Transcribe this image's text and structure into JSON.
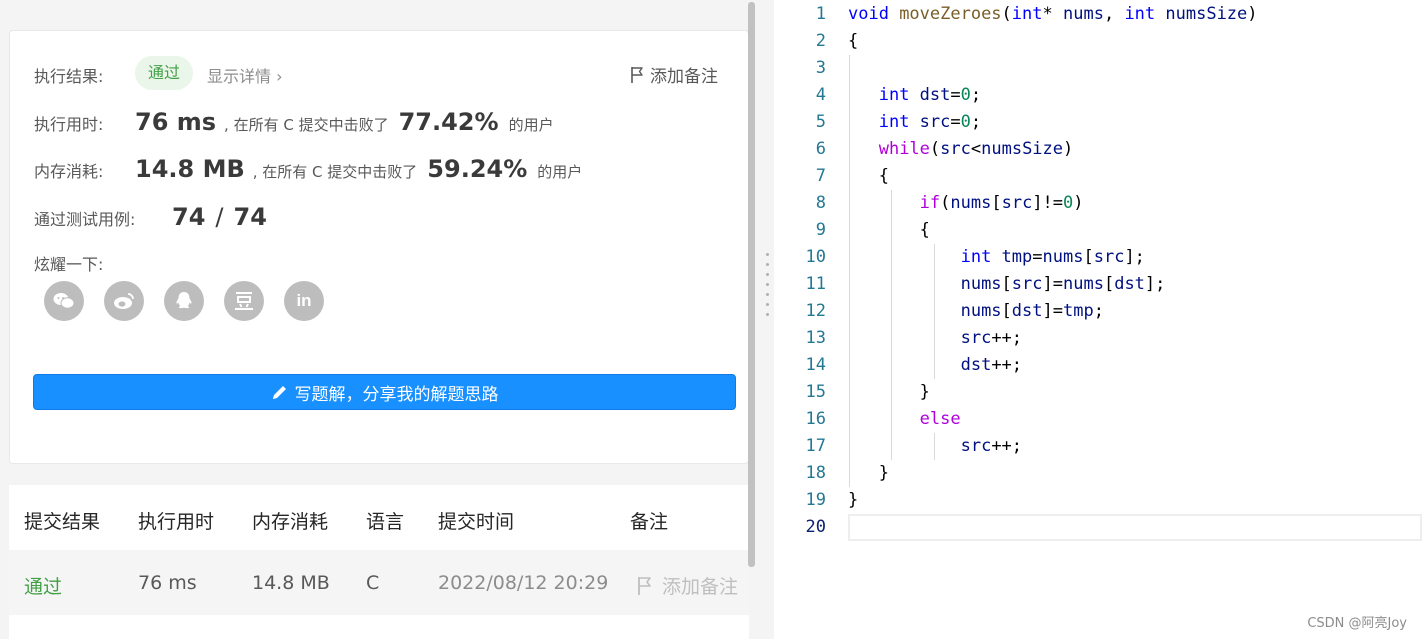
{
  "result": {
    "label": "执行结果:",
    "status": "通过",
    "detail_link": "显示详情 ›",
    "add_note": "添加备注",
    "time_label": "执行用时:",
    "time_value": "76 ms",
    "time_middle": ", 在所有 C 提交中击败了",
    "time_percent": "77.42%",
    "time_suffix": "的用户",
    "mem_label": "内存消耗:",
    "mem_value": "14.8 MB",
    "mem_middle": ", 在所有 C 提交中击败了",
    "mem_percent": "59.24%",
    "mem_suffix": "的用户",
    "cases_label": "通过测试用例:",
    "cases_passed": "74",
    "cases_sep": "/",
    "cases_total": "74",
    "share_label": "炫耀一下:",
    "share_icons": [
      "wechat-icon",
      "weibo-icon",
      "qq-icon",
      "douban-icon",
      "linkedin-icon"
    ],
    "write_button": "写题解，分享我的解题思路"
  },
  "table": {
    "headers": [
      "提交结果",
      "执行用时",
      "内存消耗",
      "语言",
      "提交时间",
      "备注"
    ],
    "row": {
      "status": "通过",
      "time": "76 ms",
      "memory": "14.8 MB",
      "lang": "C",
      "submitted": "2022/08/12 20:29",
      "note": "添加备注"
    }
  },
  "editor": {
    "line_numbers": [
      "1",
      "2",
      "3",
      "4",
      "5",
      "6",
      "7",
      "8",
      "9",
      "10",
      "11",
      "12",
      "13",
      "14",
      "15",
      "16",
      "17",
      "18",
      "19",
      "20"
    ]
  },
  "watermark": "CSDN @阿亮Joy",
  "colors": {
    "accent": "#1890ff",
    "success": "#43a047",
    "keyword": "#0000ff",
    "control": "#af00db",
    "number": "#098658",
    "function": "#795e26",
    "variable": "#001080",
    "line_number": "#237893"
  }
}
